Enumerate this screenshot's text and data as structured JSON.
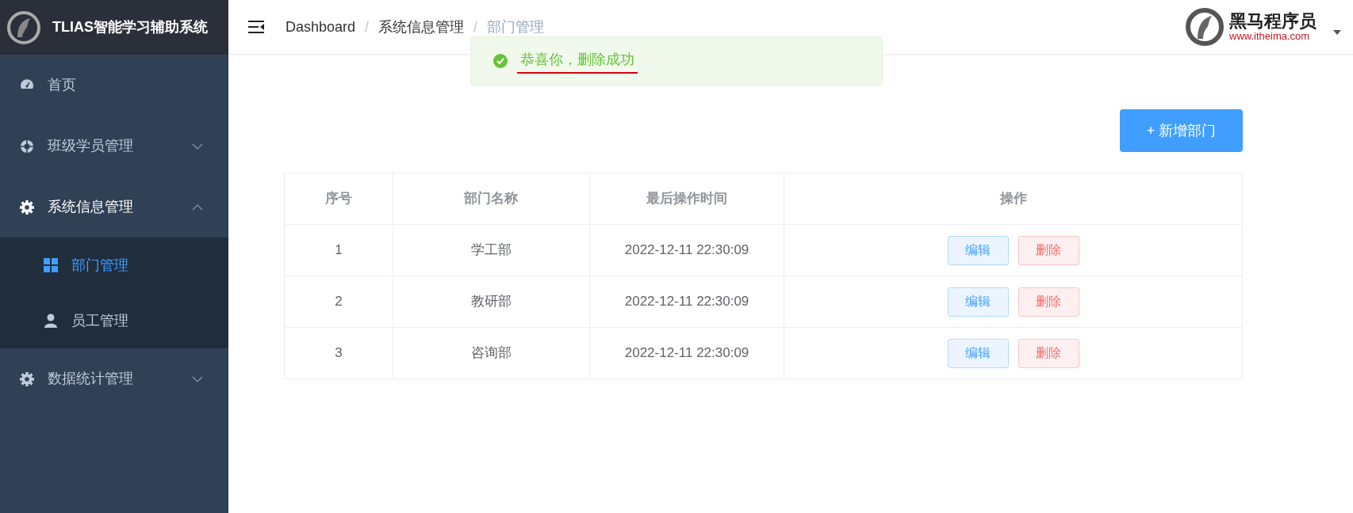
{
  "app": {
    "title": "TLIAS智能学习辅助系统"
  },
  "sidebar": {
    "items": [
      {
        "label": "首页"
      },
      {
        "label": "班级学员管理",
        "expanded": false
      },
      {
        "label": "系统信息管理",
        "expanded": true,
        "children": [
          {
            "label": "部门管理",
            "selected": true
          },
          {
            "label": "员工管理",
            "selected": false
          }
        ]
      },
      {
        "label": "数据统计管理",
        "expanded": false
      }
    ]
  },
  "breadcrumb": {
    "separator": "/",
    "items": [
      "Dashboard",
      "系统信息管理",
      "部门管理"
    ]
  },
  "brand": {
    "name": "黑马程序员",
    "site": "www.itheima.com"
  },
  "toast": {
    "kind": "success",
    "message": "恭喜你，删除成功"
  },
  "add_button": "+ 新增部门",
  "table": {
    "columns": [
      "序号",
      "部门名称",
      "最后操作时间",
      "操作"
    ],
    "rows": [
      {
        "cells": [
          "1",
          "学工部",
          "2022-12-11 22:30:09"
        ],
        "actions": [
          {
            "label": "编辑",
            "kind": "edit"
          },
          {
            "label": "删除",
            "kind": "delete"
          }
        ]
      },
      {
        "cells": [
          "2",
          "教研部",
          "2022-12-11 22:30:09"
        ],
        "actions": [
          {
            "label": "编辑",
            "kind": "edit"
          },
          {
            "label": "删除",
            "kind": "delete"
          }
        ]
      },
      {
        "cells": [
          "3",
          "咨询部",
          "2022-12-11 22:30:09"
        ],
        "actions": [
          {
            "label": "编辑",
            "kind": "edit"
          },
          {
            "label": "删除",
            "kind": "delete"
          }
        ]
      }
    ]
  }
}
